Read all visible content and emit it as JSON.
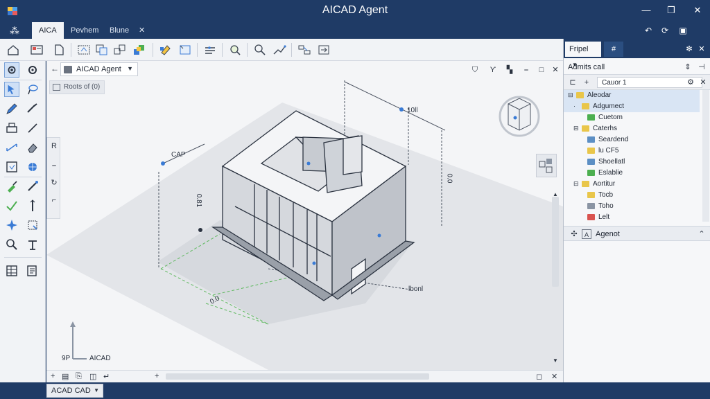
{
  "window": {
    "title": "AICAD Agent",
    "minimize_glyph": "—",
    "maximize_glyph": "❐",
    "close_glyph": "✕"
  },
  "tabs": [
    {
      "label": "AICA",
      "active": true
    },
    {
      "label": "Pevhem",
      "active": false
    },
    {
      "label": "Blune",
      "active": false
    }
  ],
  "tab_close_glyph": "✕",
  "viewport": {
    "model_dropdown": "AICAD Agent",
    "sub_tab": "Roots of (0)",
    "annotations": {
      "cap": "CAP",
      "dim_top": "10ll",
      "dim_left": "0.81",
      "dim_right": "0.0",
      "dim_bottom_left": "0.0",
      "dim_bottom_right": "lbonl",
      "axis_label": "AICAD",
      "axis_small": "9P"
    }
  },
  "statusbar": {
    "mode": "ACAD CAD"
  },
  "right_panel": {
    "tabs": [
      {
        "label": "Fripel",
        "active": true
      },
      {
        "label": "#",
        "active": false
      }
    ],
    "title": "Admits call",
    "search_value": "Cauor 1",
    "tree": [
      {
        "label": "Aleodar",
        "indent": 0,
        "twisty": "⊟",
        "color": "#e9c64a",
        "selected": true
      },
      {
        "label": "Adgumect",
        "indent": 1,
        "twisty": "·",
        "color": "#e9c64a",
        "selected": true
      },
      {
        "label": "Cuetom",
        "indent": 2,
        "twisty": "",
        "color": "#4caf50",
        "selected": false
      },
      {
        "label": "Caterhs",
        "indent": 1,
        "twisty": "⊟",
        "color": "#e9c64a",
        "selected": false
      },
      {
        "label": "Seardend",
        "indent": 2,
        "twisty": "",
        "color": "#5c8fc4",
        "selected": false
      },
      {
        "label": "lu CF5",
        "indent": 2,
        "twisty": "",
        "color": "#e9c64a",
        "selected": false
      },
      {
        "label": "Shoellatl",
        "indent": 2,
        "twisty": "",
        "color": "#5c8fc4",
        "selected": false
      },
      {
        "label": "Eslablie",
        "indent": 2,
        "twisty": "",
        "color": "#4caf50",
        "selected": false
      },
      {
        "label": "Aortitur",
        "indent": 1,
        "twisty": "⊟",
        "color": "#e9c64a",
        "selected": false
      },
      {
        "label": "Tocb",
        "indent": 2,
        "twisty": "",
        "color": "#e9c64a",
        "selected": false
      },
      {
        "label": "Toho",
        "indent": 2,
        "twisty": "",
        "color": "#8a94a3",
        "selected": false
      },
      {
        "label": "Lelt",
        "indent": 2,
        "twisty": "",
        "color": "#d9534f",
        "selected": false
      }
    ],
    "agent_label": "Agenot"
  },
  "colors": {
    "chrome": "#1f3b66",
    "panel": "#f1f3f6",
    "accent": "#3a7bd5"
  }
}
